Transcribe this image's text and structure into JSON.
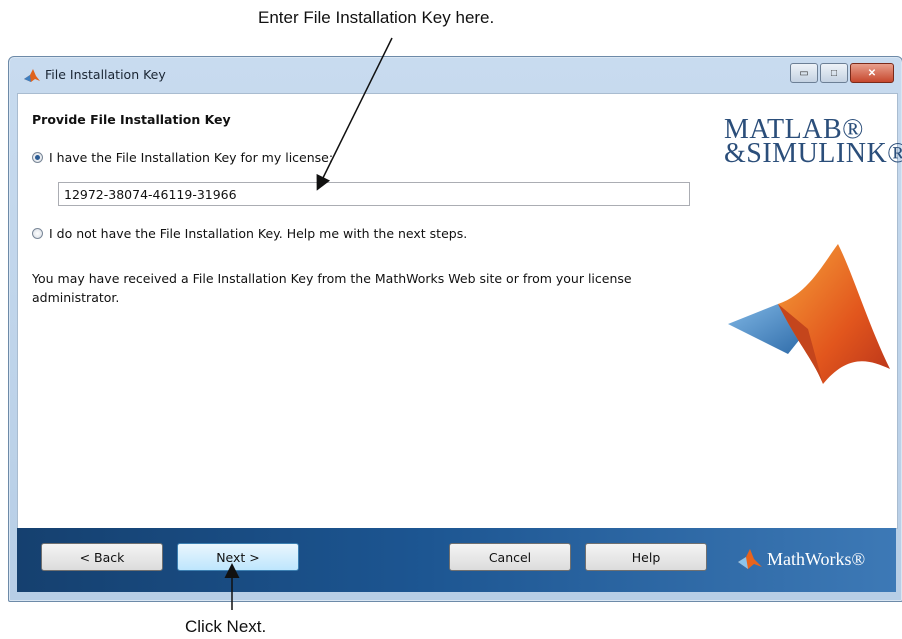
{
  "annotations": {
    "top": "Enter File Installation Key here.",
    "bottom": "Click Next."
  },
  "window": {
    "title": "File Installation Key",
    "controls": {
      "minimize": "▭",
      "maximize": "□",
      "close": "✕"
    }
  },
  "content": {
    "heading": "Provide File Installation Key",
    "option_have_key": "I have the File Installation Key for my license:",
    "key_value": "12972-38074-46119-31966",
    "option_no_key": "I do not have the File Installation Key.  Help me with the next steps.",
    "info_text": "You may have received a File Installation Key from the MathWorks Web site or from your license administrator."
  },
  "branding": {
    "logo_line1": "MATLAB®",
    "logo_line2": "&SIMULINK®",
    "footer_logo": "MathWorks®"
  },
  "buttons": {
    "back": "< Back",
    "next": "Next >",
    "cancel": "Cancel",
    "help": "Help"
  },
  "state": {
    "selected_option": "have_key"
  }
}
